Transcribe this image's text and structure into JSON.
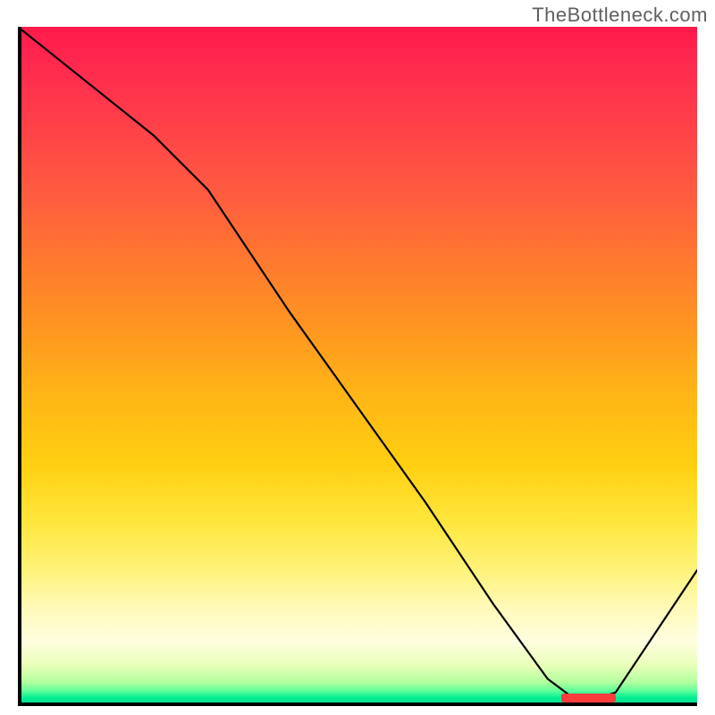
{
  "watermark": "TheBottleneck.com",
  "chart_data": {
    "type": "line",
    "title": "",
    "xlabel": "",
    "ylabel": "",
    "xlim": [
      0,
      100
    ],
    "ylim": [
      0,
      100
    ],
    "x": [
      0,
      10,
      20,
      28,
      40,
      50,
      60,
      70,
      78,
      82,
      85,
      88,
      100
    ],
    "values": [
      100,
      92,
      84,
      76,
      58,
      44,
      30,
      15,
      4,
      1,
      1,
      2,
      20
    ],
    "grid": false,
    "legend": false
  },
  "marker_region": {
    "x_start": 80,
    "x_end": 88,
    "color": "#ff3b3b"
  }
}
